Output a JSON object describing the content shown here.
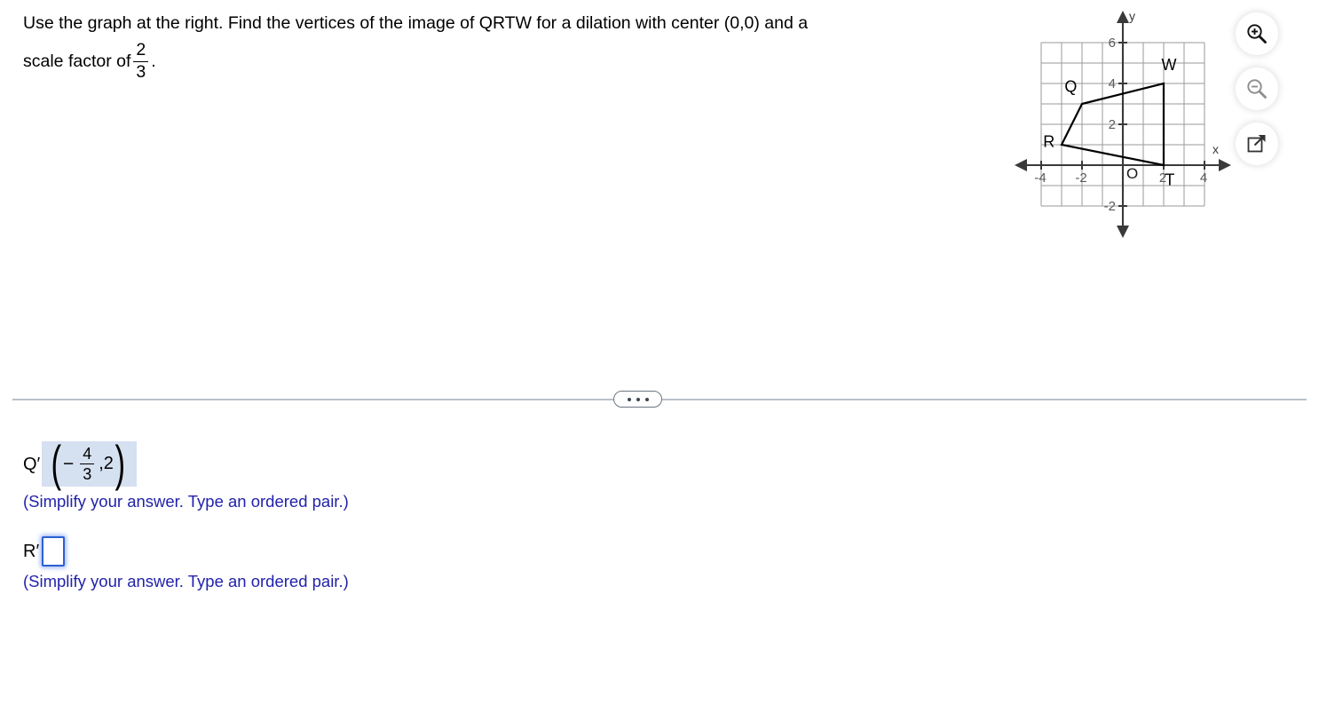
{
  "question": {
    "line1": "Use the graph at the right. Find the vertices of the image of QRTW for a dilation with center (0,0) and a",
    "line2_prefix": "scale factor of",
    "scale_numerator": "2",
    "scale_denominator": "3",
    "line2_suffix": "."
  },
  "toolbar": {
    "zoom_in": "zoom-in",
    "zoom_out": "zoom-out",
    "open_new_window": "open-in-new-window"
  },
  "divider": {
    "more_label": "..."
  },
  "answers": [
    {
      "label": "Q′",
      "filled": true,
      "value_numerator": "4",
      "value_denominator": "3",
      "value_sign": "−",
      "value_y": ",2",
      "hint": "(Simplify your answer. Type an ordered pair.)"
    },
    {
      "label": "R′",
      "filled": false,
      "value": "",
      "placeholder": "",
      "hint": "(Simplify your answer. Type an ordered pair.)"
    }
  ],
  "colors": {
    "hint_blue": "#2222aa",
    "input_border": "#2c5fd4",
    "answer_highlight": "#d5e0f0",
    "grid_line": "#9a9a9a",
    "axis": "#3a3a3a",
    "shape_stroke": "#000000"
  },
  "chart_data": {
    "type": "scatter",
    "title": "",
    "xlabel": "x",
    "ylabel": "y",
    "xlim": [
      -4,
      4
    ],
    "ylim": [
      -2,
      6
    ],
    "grid": true,
    "x_ticks": [
      -4,
      -2,
      2,
      4
    ],
    "x_tick_labels": [
      "-4",
      "-2",
      "2",
      "4"
    ],
    "y_ticks": [
      -2,
      2,
      4,
      6
    ],
    "y_tick_labels": [
      "-2",
      "2",
      "4",
      "6"
    ],
    "origin_label": "O",
    "polygon": {
      "name": "QRTW",
      "closed": true,
      "vertices": [
        {
          "label": "Q",
          "x": -2,
          "y": 3,
          "label_dx": -0.55,
          "label_dy": 0.85
        },
        {
          "label": "R",
          "x": -3,
          "y": 1,
          "label_dx": -0.62,
          "label_dy": 0.16
        },
        {
          "label": "T",
          "x": 2,
          "y": 0,
          "label_dx": 0.3,
          "label_dy": -0.72
        },
        {
          "label": "W",
          "x": 2,
          "y": 4,
          "label_dx": 0.26,
          "label_dy": 0.92
        }
      ]
    }
  }
}
